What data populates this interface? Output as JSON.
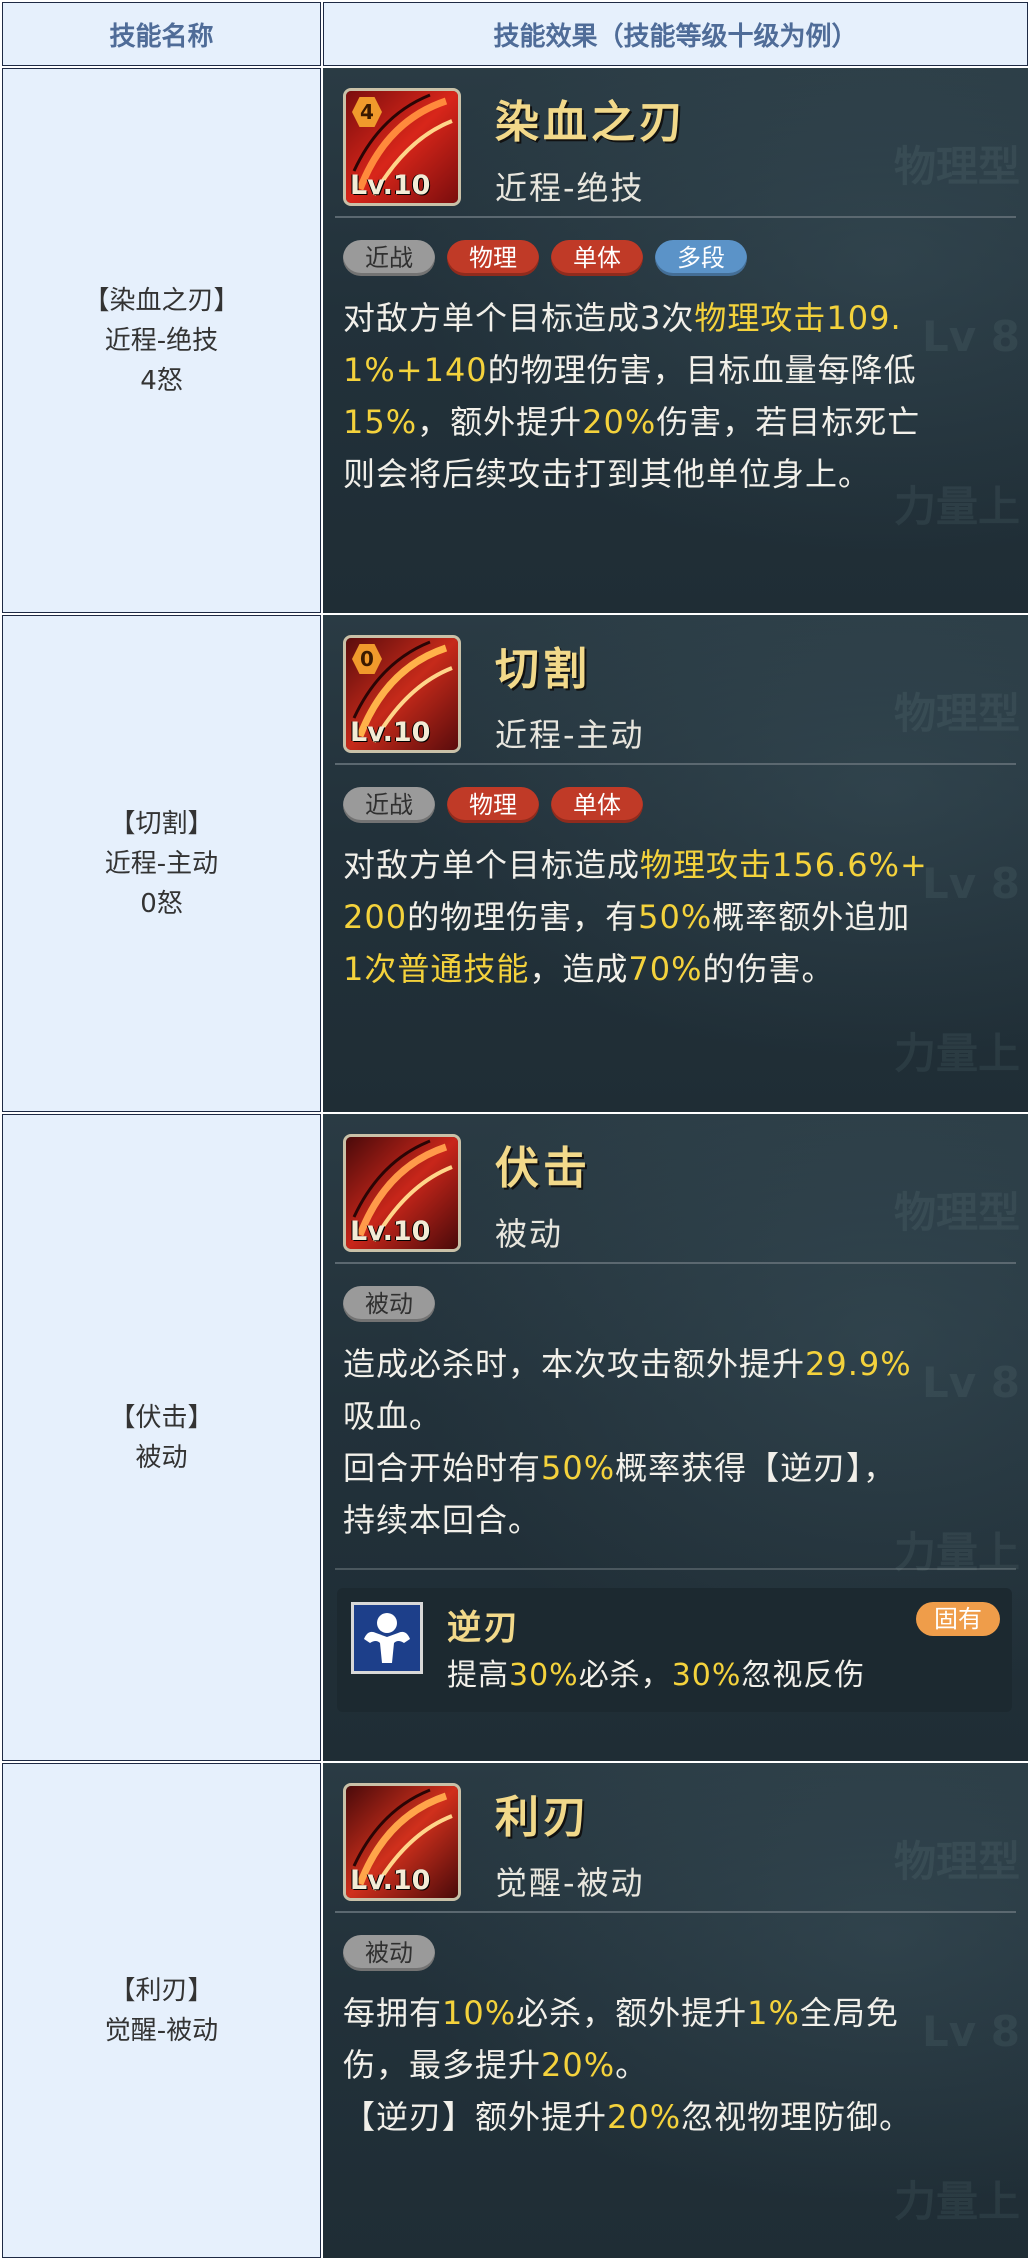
{
  "header": {
    "col_name": "技能名称",
    "col_effect": "技能效果（技能等级十级为例）"
  },
  "skills": [
    {
      "name_lines": [
        "【染血之刃】",
        "近程-绝技",
        "4怒"
      ],
      "title": "染血之刃",
      "type": "近程-绝技",
      "level": "Lv.10",
      "cost": "4",
      "tags": [
        {
          "text": "近战",
          "color": "gray"
        },
        {
          "text": "物理",
          "color": "red"
        },
        {
          "text": "单体",
          "color": "red"
        },
        {
          "text": "多段",
          "color": "blue"
        }
      ],
      "desc_lines": [
        [
          {
            "t": "对敌方单个目标造成3次"
          },
          {
            "t": "物理攻击109.",
            "h": true
          }
        ],
        [
          {
            "t": "1%+140",
            "h": true
          },
          {
            "t": "的物理伤害，目标血量每降低"
          }
        ],
        [
          {
            "t": "15%",
            "h": true
          },
          {
            "t": "，额外提升"
          },
          {
            "t": "20%",
            "h": true
          },
          {
            "t": "伤害，若目标死亡"
          }
        ],
        [
          {
            "t": "则会将后续攻击打到其他单位身上。"
          }
        ]
      ]
    },
    {
      "name_lines": [
        "【切割】",
        "近程-主动",
        "0怒"
      ],
      "title": "切割",
      "type": "近程-主动",
      "level": "Lv.10",
      "cost": "0",
      "tags": [
        {
          "text": "近战",
          "color": "gray"
        },
        {
          "text": "物理",
          "color": "red"
        },
        {
          "text": "单体",
          "color": "red"
        }
      ],
      "desc_lines": [
        [
          {
            "t": "对敌方单个目标造成"
          },
          {
            "t": "物理攻击156.6%+",
            "h": true
          }
        ],
        [
          {
            "t": "200",
            "h": true
          },
          {
            "t": "的物理伤害，有"
          },
          {
            "t": "50%",
            "h": true
          },
          {
            "t": "概率额外追加"
          }
        ],
        [
          {
            "t": "1次普通技能",
            "h": true
          },
          {
            "t": "，造成"
          },
          {
            "t": "70%",
            "h": true
          },
          {
            "t": "的伤害。"
          }
        ]
      ]
    },
    {
      "name_lines": [
        "【伏击】",
        "被动"
      ],
      "title": "伏击",
      "type": "被动",
      "level": "Lv.10",
      "cost": "",
      "tags": [
        {
          "text": "被动",
          "color": "gray"
        }
      ],
      "desc_lines": [
        [
          {
            "t": "造成必杀时，本次攻击额外提升"
          },
          {
            "t": "29.9%",
            "h": true
          }
        ],
        [
          {
            "t": "吸血。"
          }
        ],
        [
          {
            "t": "回合开始时有"
          },
          {
            "t": "50%",
            "h": true
          },
          {
            "t": "概率获得【逆刃】，"
          }
        ],
        [
          {
            "t": "持续本回合。"
          }
        ]
      ],
      "sub": {
        "title": "逆刃",
        "badge": "固有",
        "desc": [
          {
            "t": "提高"
          },
          {
            "t": "30%",
            "h": true
          },
          {
            "t": "必杀，"
          },
          {
            "t": "30%",
            "h": true
          },
          {
            "t": "忽视反伤"
          }
        ]
      }
    },
    {
      "name_lines": [
        "【利刃】",
        "觉醒-被动"
      ],
      "title": "利刃",
      "type": "觉醒-被动",
      "level": "Lv.10",
      "cost": "",
      "tags": [
        {
          "text": "被动",
          "color": "gray"
        }
      ],
      "desc_lines": [
        [
          {
            "t": "每拥有"
          },
          {
            "t": "10%",
            "h": true
          },
          {
            "t": "必杀，额外提升"
          },
          {
            "t": "1%",
            "h": true
          },
          {
            "t": "全局免"
          }
        ],
        [
          {
            "t": "伤，最多提升"
          },
          {
            "t": "20%",
            "h": true
          },
          {
            "t": "。"
          }
        ],
        [
          {
            "t": "【逆刃】额外提升"
          },
          {
            "t": "20%",
            "h": true
          },
          {
            "t": "忽视物理防御。"
          }
        ]
      ]
    }
  ],
  "colors": {
    "header_bg": "#e6f0fc",
    "header_text": "#4f6c98",
    "panel_bg": "#23323a",
    "highlight": "#f4d23c",
    "title_gold": "#f2d98a",
    "tag_gray": "#9a9a9a",
    "tag_red": "#c03a27",
    "tag_blue": "#5b93c8",
    "badge_orange": "#ef9d4a"
  },
  "icons": {
    "skill_icon": "red-slash-icon",
    "sub_icon": "muscle-buff-icon"
  }
}
